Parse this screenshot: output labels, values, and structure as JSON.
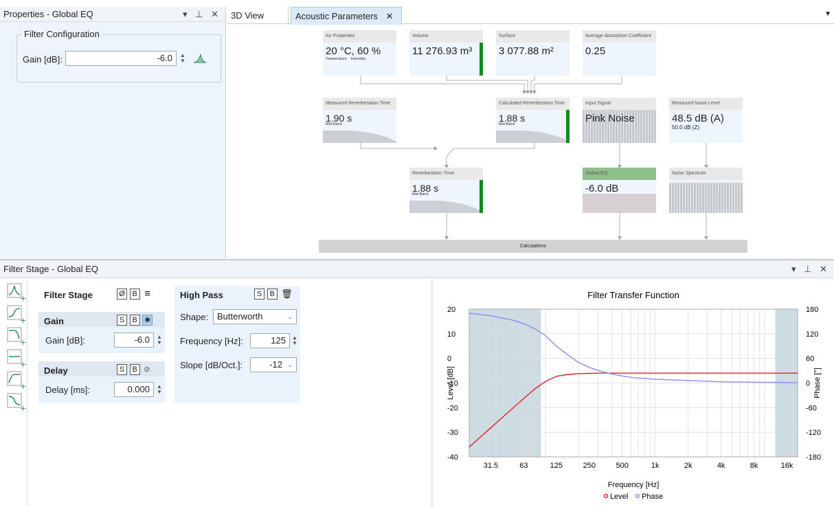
{
  "properties_panel": {
    "title": "Properties - Global EQ",
    "ctrl_labels": "▾ ⊥ ✕",
    "group_label": "Filter Configuration",
    "gain_label": "Gain [dB]:",
    "gain_value": "-6.0"
  },
  "tabs": [
    {
      "label": "3D View",
      "active": false
    },
    {
      "label": "Acoustic Parameters",
      "active": true,
      "close": "✕"
    }
  ],
  "diagram": {
    "air_properties": {
      "header": "Air Properties",
      "temp": "20 °C,",
      "humidity": "60 %",
      "temp_label": "Temperature",
      "humidity_label": "Humidity"
    },
    "volume": {
      "header": "Volume",
      "value": "11 276.93 m³"
    },
    "surface": {
      "header": "Surface",
      "value": "3 077.88 m²"
    },
    "avg_absorption": {
      "header": "Average Absorption Coefficient",
      "value": "0.25"
    },
    "measured_rt": {
      "header": "Measured Reverberation Time",
      "value": "1.90 s",
      "sub": "Mid-Band"
    },
    "calculated_rt": {
      "header": "Calculated Reverberation Time",
      "value": "1.88 s",
      "sub": "Mid-Band"
    },
    "input_signal": {
      "header": "Input Signal",
      "value": "Pink Noise"
    },
    "measured_noise": {
      "header": "Measured Noise Level",
      "value": "48.5 dB (A)",
      "sub": "50.0  dB (Z)"
    },
    "reverb_time": {
      "header": "Reverberation Time",
      "value": "1.88 s",
      "sub": "Mid-Band"
    },
    "global_eq": {
      "header": "Global EQ",
      "value": "-6.0 dB"
    },
    "noise_spectrum": {
      "header": "Noise Spectrum"
    },
    "calculations": {
      "label": "Calculations"
    }
  },
  "filter_panel": {
    "title": "Filter Stage - Global EQ",
    "ctrl_labels": "▾ ⊥ ✕",
    "filter_stage": {
      "label": "Filter Stage",
      "btn_phase": "Ø",
      "btn_b": "B",
      "btn_menu": "≡"
    },
    "gain": {
      "label": "Gain",
      "btn_s": "S",
      "btn_b": "B",
      "field_label": "Gain [dB]:",
      "value": "-6.0"
    },
    "delay": {
      "label": "Delay",
      "btn_s": "S",
      "btn_b": "B",
      "field_label": "Delay [ms]:",
      "value": "0.000"
    },
    "high_pass": {
      "label": "High Pass",
      "btn_s": "S",
      "btn_b": "B",
      "shape_label": "Shape:",
      "shape_value": "Butterworth",
      "freq_label": "Frequency [Hz]:",
      "freq_value": "125",
      "slope_label": "Slope [dB/Oct.]:",
      "slope_value": "-12"
    }
  },
  "chart_data": {
    "type": "line",
    "title": "Filter Transfer Function",
    "xlabel": "Frequency [Hz]",
    "ylabel": "Level [dB]",
    "y2label": "Phase [°]",
    "x_scale": "log",
    "x_ticks": [
      "31.5",
      "63",
      "125",
      "250",
      "500",
      "1k",
      "2k",
      "4k",
      "8k",
      "16k"
    ],
    "x_tick_values": [
      31.5,
      63,
      125,
      250,
      500,
      1000,
      2000,
      4000,
      8000,
      16000
    ],
    "xlim": [
      20,
      20000
    ],
    "ylim": [
      -40,
      20
    ],
    "y_ticks": [
      "20",
      "10",
      "0",
      "-10",
      "-20",
      "-30",
      "-40"
    ],
    "y2lim": [
      -180,
      180
    ],
    "y2_ticks": [
      "180",
      "120",
      "60",
      "0",
      "-60",
      "-120",
      "-180"
    ],
    "shaded_bands": [
      [
        20,
        90
      ],
      [
        12500,
        20000
      ]
    ],
    "grid": true,
    "legend_position": "bottom",
    "series": [
      {
        "name": "Level",
        "color": "#e0202a",
        "axis": "left",
        "x": [
          20,
          31.5,
          50,
          63,
          80,
          100,
          125,
          160,
          200,
          250,
          315,
          400,
          500,
          1000,
          2000,
          4000,
          8000,
          16000,
          20000
        ],
        "y": [
          -36,
          -28.2,
          -20.2,
          -16.3,
          -12.3,
          -9.3,
          -7.3,
          -6.5,
          -6.2,
          -6.1,
          -6.0,
          -6.0,
          -6.0,
          -6.0,
          -6.0,
          -6.0,
          -6.0,
          -6.0,
          -6.0
        ]
      },
      {
        "name": "Phase",
        "color": "#8b8bf5",
        "axis": "right",
        "x": [
          20,
          31.5,
          50,
          63,
          80,
          100,
          125,
          160,
          200,
          250,
          315,
          400,
          500,
          630,
          800,
          1000,
          2000,
          4000,
          8000,
          16000,
          20000
        ],
        "y": [
          170,
          164,
          153,
          145,
          132,
          115,
          90,
          68,
          50,
          38,
          29,
          22,
          17,
          13,
          11,
          9,
          6,
          3,
          2,
          1,
          1
        ]
      }
    ]
  },
  "colors": {
    "level": "#e0202a",
    "phase": "#8b8bf5",
    "accent_green": "#108a1a",
    "shade": "#bcd0d9"
  }
}
